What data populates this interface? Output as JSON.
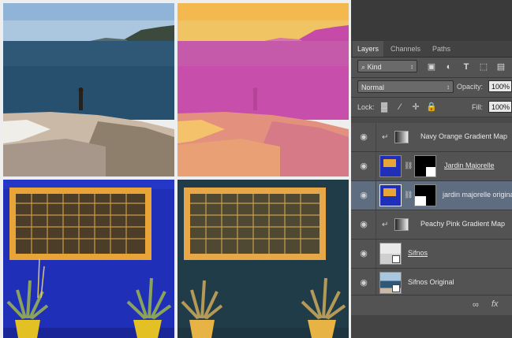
{
  "panel": {
    "tabs": [
      "Layers",
      "Channels",
      "Paths"
    ],
    "filter": {
      "label": "Kind"
    },
    "blend_mode": "Normal",
    "opacity": {
      "label": "Opacity:",
      "value": "100%"
    },
    "lock_label": "Lock:",
    "fill": {
      "label": "Fill:",
      "value": "100%"
    },
    "layers": [
      {
        "name": "Navy Orange Gradient Map",
        "type": "adjustment",
        "clipped": true,
        "selected": false
      },
      {
        "name": "Jardin Majorelle",
        "type": "pixel-mask",
        "clipped": false,
        "selected": false
      },
      {
        "name": "jardin majorelle original",
        "type": "pixel-mask",
        "clipped": false,
        "selected": true
      },
      {
        "name": "Peachy Pink Gradient Map",
        "type": "adjustment",
        "clipped": true,
        "selected": false
      },
      {
        "name": "Sifnos",
        "type": "smart",
        "clipped": false,
        "selected": false
      },
      {
        "name": "Sifnos Original",
        "type": "smart",
        "clipped": false,
        "selected": false
      }
    ],
    "bottom_icons": [
      "link-icon",
      "fx-icon"
    ]
  }
}
